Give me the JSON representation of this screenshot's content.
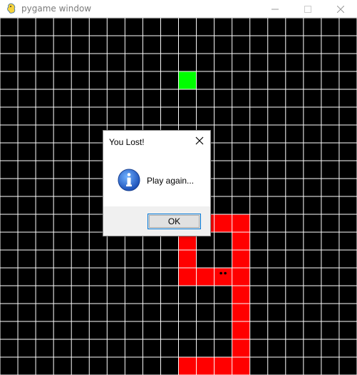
{
  "window": {
    "title": "pygame window",
    "app_icon": "pygame-snake-icon",
    "controls": [
      "minimize-icon",
      "maximize-icon",
      "close-icon"
    ]
  },
  "game": {
    "background_color": "#000000",
    "grid_color": "#ffffff",
    "grid_cells": 20,
    "food": {
      "color": "#00ff00",
      "cell": [
        10,
        3
      ]
    },
    "snake": {
      "color": "#ff0000",
      "eye_color": "#000000",
      "head_cell": [
        12,
        14
      ],
      "body_cells": [
        [
          10,
          12
        ],
        [
          10,
          13
        ],
        [
          10,
          14
        ],
        [
          11,
          14
        ],
        [
          12,
          14
        ],
        [
          11,
          11
        ],
        [
          12,
          11
        ],
        [
          13,
          11
        ],
        [
          13,
          12
        ],
        [
          13,
          13
        ],
        [
          13,
          14
        ],
        [
          13,
          15
        ],
        [
          13,
          16
        ],
        [
          13,
          17
        ],
        [
          13,
          18
        ],
        [
          13,
          19
        ],
        [
          10,
          19
        ],
        [
          11,
          19
        ],
        [
          12,
          19
        ]
      ]
    }
  },
  "dialog": {
    "title": "You Lost!",
    "message": "Play again...",
    "icon": "information-icon",
    "ok_label": "OK"
  }
}
